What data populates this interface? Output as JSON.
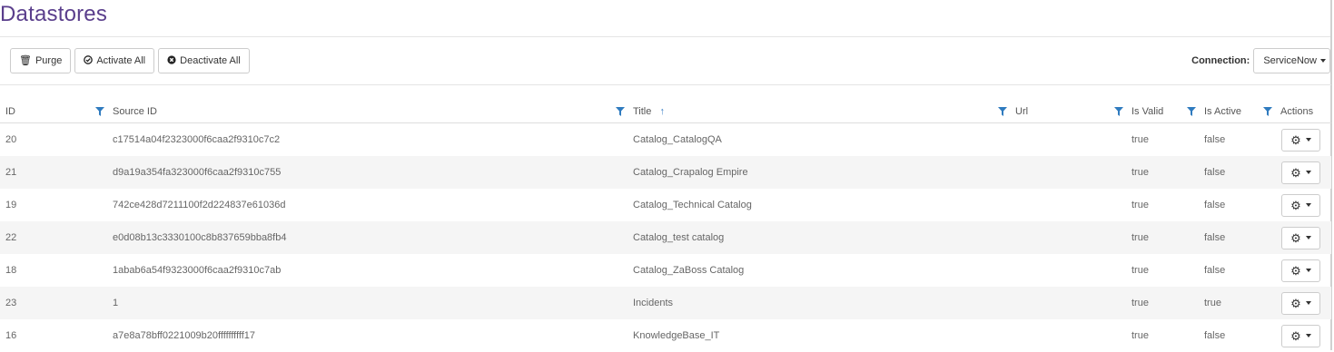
{
  "page": {
    "title": "Datastores"
  },
  "toolbar": {
    "purge_label": "Purge",
    "activate_all_label": "Activate All",
    "deactivate_all_label": "Deactivate All"
  },
  "connection": {
    "label": "Connection:",
    "value": "ServiceNow"
  },
  "table": {
    "headers": {
      "id": "ID",
      "source_id": "Source ID",
      "title": "Title",
      "url": "Url",
      "is_valid": "Is Valid",
      "is_active": "Is Active",
      "actions": "Actions"
    },
    "sort": {
      "column": "title",
      "direction": "ascending",
      "glyph": "↑"
    },
    "rows": [
      {
        "id": "20",
        "source_id": "c17514a04f2323000f6caa2f9310c7c2",
        "title": "Catalog_CatalogQA",
        "url": "",
        "is_valid": "true",
        "is_active": "false"
      },
      {
        "id": "21",
        "source_id": "d9a19a354fa323000f6caa2f9310c755",
        "title": "Catalog_Crapalog Empire",
        "url": "",
        "is_valid": "true",
        "is_active": "false"
      },
      {
        "id": "19",
        "source_id": "742ce428d7211100f2d224837e61036d",
        "title": "Catalog_Technical Catalog",
        "url": "",
        "is_valid": "true",
        "is_active": "false"
      },
      {
        "id": "22",
        "source_id": "e0d08b13c3330100c8b837659bba8fb4",
        "title": "Catalog_test catalog",
        "url": "",
        "is_valid": "true",
        "is_active": "false"
      },
      {
        "id": "18",
        "source_id": "1abab6a54f9323000f6caa2f9310c7ab",
        "title": "Catalog_ZaBoss Catalog",
        "url": "",
        "is_valid": "true",
        "is_active": "false"
      },
      {
        "id": "23",
        "source_id": "1",
        "title": "Incidents",
        "url": "",
        "is_valid": "true",
        "is_active": "true"
      },
      {
        "id": "16",
        "source_id": "a7e8a78bff0221009b20ffffffffff17",
        "title": "KnowledgeBase_IT",
        "url": "",
        "is_valid": "true",
        "is_active": "false"
      }
    ]
  },
  "icons": {
    "purge": "trash-icon",
    "activate": "check-circle-icon",
    "deactivate": "x-circle-icon",
    "filter": "filter-icon",
    "actions": "gear-icon"
  },
  "colors": {
    "title": "#5a3e8c",
    "filter": "#2f7bbf",
    "stripe": "#f5f5f5"
  }
}
